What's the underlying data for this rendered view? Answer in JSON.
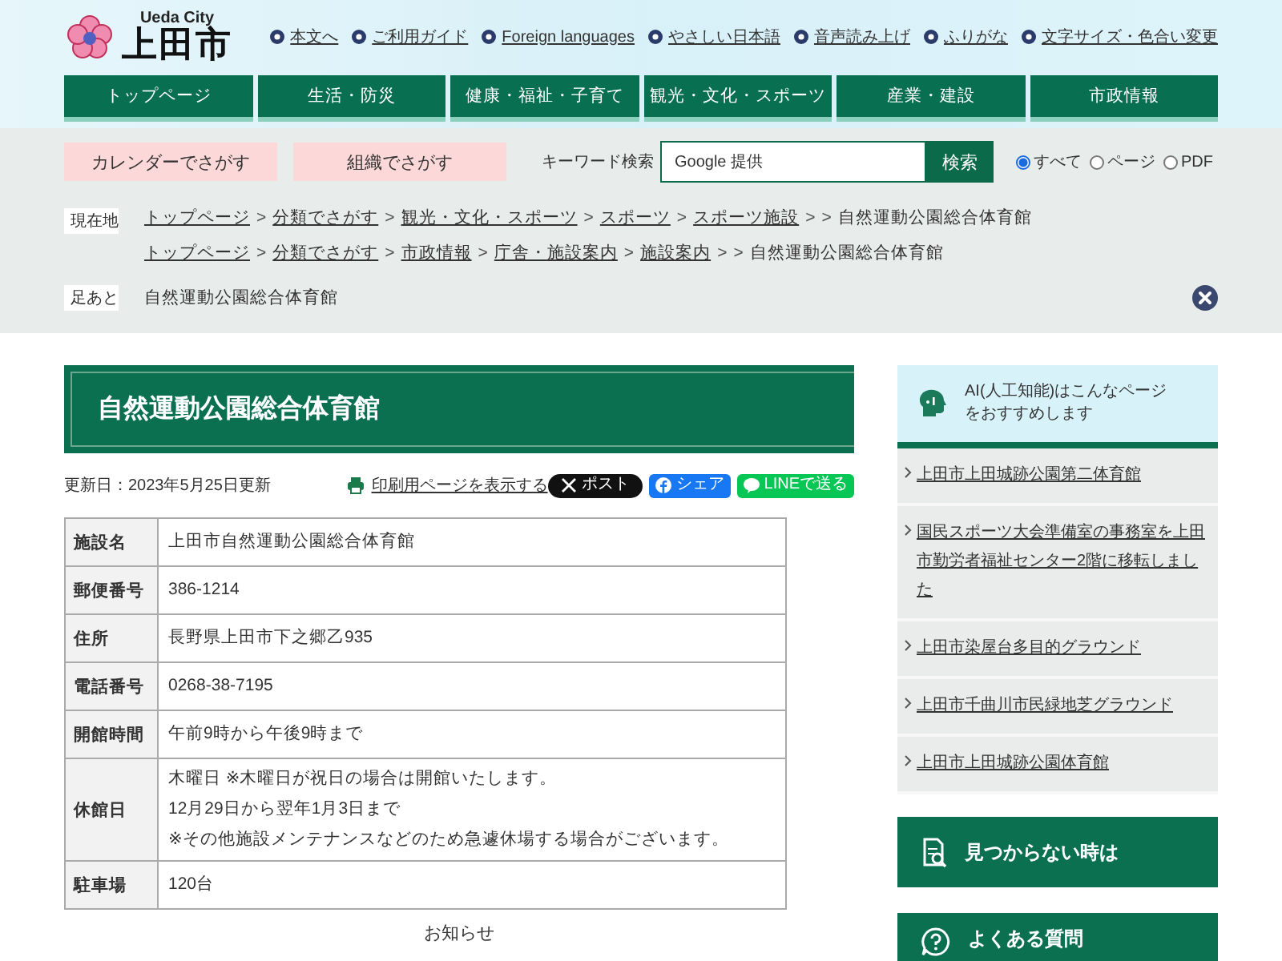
{
  "header": {
    "logo": {
      "en": "Ueda City",
      "name": "上田市"
    },
    "utility_links": [
      "本文へ",
      "ご利用ガイド",
      "Foreign languages",
      "やさしい日本語",
      "音声読み上げ",
      "ふりがな",
      "文字サイズ・色合い変更"
    ],
    "nav": [
      "トップページ",
      "生活・防災",
      "健康・福祉・子育て",
      "観光・文化・スポーツ",
      "産業・建設",
      "市政情報"
    ]
  },
  "search_bar": {
    "buttons": [
      "カレンダーでさがす",
      "組織でさがす"
    ],
    "keyword_label": "キーワード検索",
    "search_field": {
      "placeholder": "Google 提供"
    },
    "search_button": "検索",
    "scope_options": [
      {
        "label": "すべて",
        "selected": true
      },
      {
        "label": "ページ",
        "selected": false
      },
      {
        "label": "PDF",
        "selected": false
      }
    ]
  },
  "breadcrumbs": {
    "label": "現在地",
    "trails": [
      [
        {
          "kind": "link",
          "text": "トップページ"
        },
        {
          "kind": "sep",
          "text": ">"
        },
        {
          "kind": "link",
          "text": "分類でさがす"
        },
        {
          "kind": "sep",
          "text": ">"
        },
        {
          "kind": "link",
          "text": "観光・文化・スポーツ"
        },
        {
          "kind": "sep",
          "text": ">"
        },
        {
          "kind": "link",
          "text": "スポーツ"
        },
        {
          "kind": "sep",
          "text": ">"
        },
        {
          "kind": "link",
          "text": "スポーツ施設"
        },
        {
          "kind": "sep",
          "text": ">"
        },
        {
          "kind": "sep",
          "text": ">"
        },
        {
          "kind": "current",
          "text": "自然運動公園総合体育館"
        }
      ],
      [
        {
          "kind": "link",
          "text": "トップページ"
        },
        {
          "kind": "sep",
          "text": ">"
        },
        {
          "kind": "link",
          "text": "分類でさがす"
        },
        {
          "kind": "sep",
          "text": ">"
        },
        {
          "kind": "link",
          "text": "市政情報"
        },
        {
          "kind": "sep",
          "text": ">"
        },
        {
          "kind": "link",
          "text": "庁舎・施設案内"
        },
        {
          "kind": "sep",
          "text": ">"
        },
        {
          "kind": "link",
          "text": "施設案内"
        },
        {
          "kind": "sep",
          "text": ">"
        },
        {
          "kind": "sep",
          "text": ">"
        },
        {
          "kind": "current",
          "text": "自然運動公園総合体育館"
        }
      ]
    ]
  },
  "footprints": {
    "label": "足あと",
    "items": [
      "自然運動公園総合体育館"
    ]
  },
  "article": {
    "title": "自然運動公園総合体育館",
    "updated": "更新日：2023年5月25日更新",
    "print_link": "印刷用ページを表示する",
    "share_buttons": [
      {
        "kind": "x",
        "label": "ポスト"
      },
      {
        "kind": "facebook",
        "label": "シェア"
      },
      {
        "kind": "line",
        "label": "LINEで送る"
      }
    ],
    "table": {
      "rows": [
        {
          "label": "施設名",
          "lines": [
            "上田市自然運動公園総合体育館"
          ]
        },
        {
          "label": "郵便番号",
          "lines": [
            "386-1214"
          ]
        },
        {
          "label": "住所",
          "lines": [
            "長野県上田市下之郷乙935"
          ]
        },
        {
          "label": "電話番号",
          "lines": [
            "0268-38-7195"
          ]
        },
        {
          "label": "開館時間",
          "lines": [
            "午前9時から午後9時まで"
          ]
        },
        {
          "label": "休館日",
          "lines": [
            "木曜日 ※木曜日が祝日の場合は開館いたします。",
            "12月29日から翌年1月3日まで",
            "※その他施設メンテナンスなどのため急遽休場する場合がございます。"
          ]
        },
        {
          "label": "駐車場",
          "lines": [
            "120台"
          ]
        }
      ]
    },
    "next_heading": "お知らせ"
  },
  "sidebar": {
    "ai_title": "AI(人工知能)はこんなページをおすすめします",
    "recommendations": [
      "上田市上田城跡公園第二体育館",
      "国民スポーツ大会準備室の事務室を上田市勤労者福祉センター2階に移転しました",
      "上田市染屋台多目的グラウンド",
      "上田市千曲川市民緑地芝グラウンド",
      "上田市上田城跡公園体育館"
    ],
    "panels": [
      {
        "kind": "not_found",
        "label": "見つからない時は"
      },
      {
        "kind": "faq",
        "label": "よくある質問"
      }
    ]
  }
}
